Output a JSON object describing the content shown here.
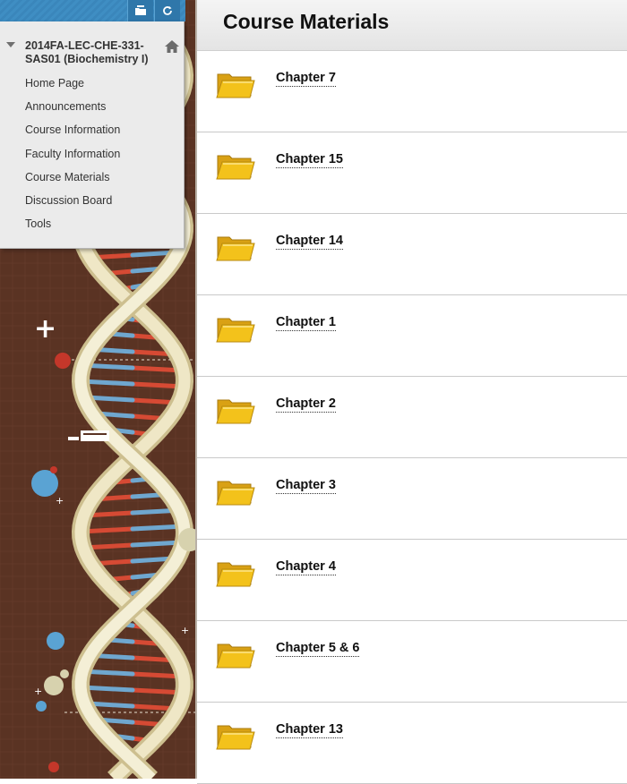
{
  "menu": {
    "course_title": "2014FA-LEC-CHE-331-SAS01 (Biochemistry I)",
    "items": [
      {
        "label": "Home Page"
      },
      {
        "label": "Announcements"
      },
      {
        "label": "Course Information"
      },
      {
        "label": "Faculty Information"
      },
      {
        "label": "Course Materials"
      },
      {
        "label": "Discussion Board"
      },
      {
        "label": "Tools"
      }
    ],
    "toolbar_icons": [
      "folder-view-icon",
      "refresh-icon"
    ],
    "accent_color": "#3a86bb"
  },
  "content": {
    "title": "Course Materials",
    "items": [
      {
        "label": "Chapter 7",
        "icon": "folder-icon"
      },
      {
        "label": "Chapter 15",
        "icon": "folder-icon"
      },
      {
        "label": "Chapter 14",
        "icon": "folder-icon"
      },
      {
        "label": "Chapter 1",
        "icon": "folder-icon"
      },
      {
        "label": "Chapter 2",
        "icon": "folder-icon"
      },
      {
        "label": "Chapter 3",
        "icon": "folder-icon"
      },
      {
        "label": "Chapter 4",
        "icon": "folder-icon"
      },
      {
        "label": "Chapter 5 & 6",
        "icon": "folder-icon"
      },
      {
        "label": "Chapter 13",
        "icon": "folder-icon"
      }
    ]
  },
  "theme": {
    "background_brown": "#5a3323",
    "folder_yellow": "#f3c21b"
  }
}
